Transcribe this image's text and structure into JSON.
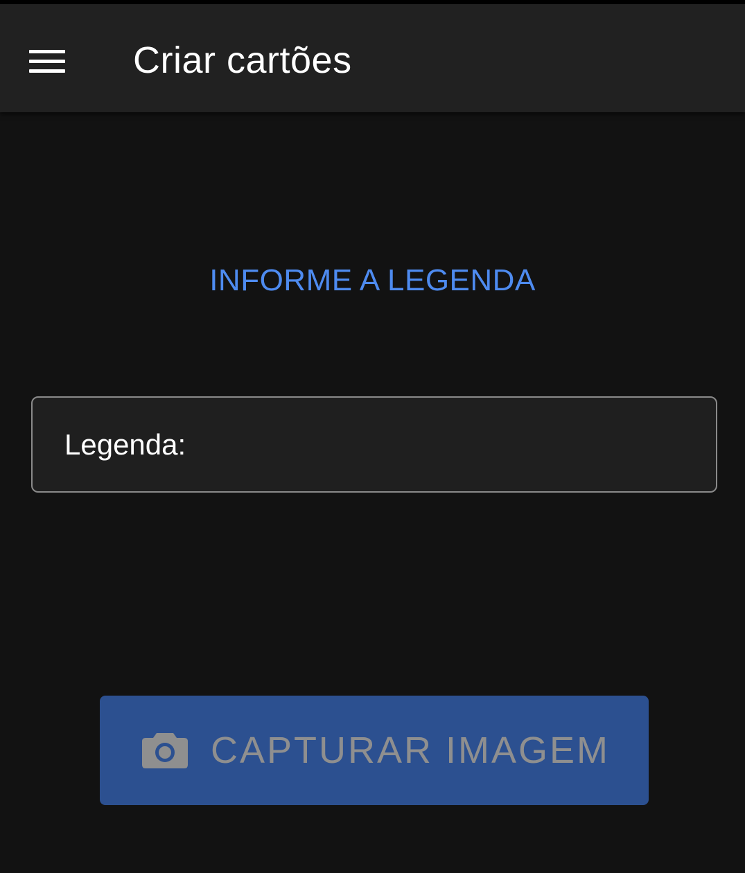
{
  "header": {
    "title": "Criar cartões",
    "menu_icon": "hamburger-menu-icon"
  },
  "main": {
    "prompt": "INFORME A LEGENDA",
    "caption_field": {
      "label": "Legenda:",
      "value": "",
      "placeholder": ""
    },
    "capture_button": {
      "label": "CAPTURAR IMAGEM",
      "icon": "camera-icon"
    }
  },
  "colors": {
    "background": "#121212",
    "appbar": "#212121",
    "accent_text": "#4e8bf0",
    "button_bg": "#2c5090",
    "button_text": "#8f8f8f"
  }
}
